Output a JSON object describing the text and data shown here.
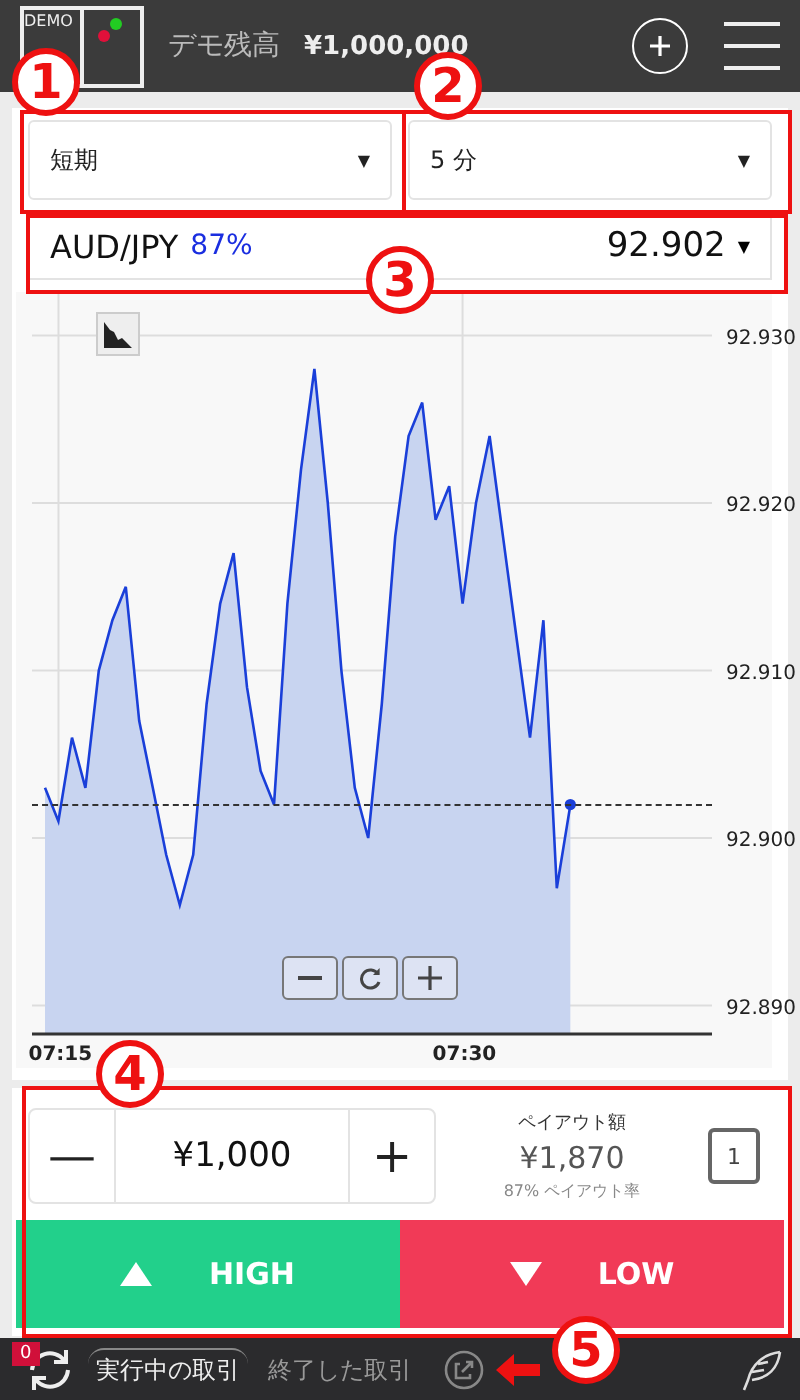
{
  "header": {
    "logo_text": "DEMO",
    "balance_label": "デモ残高",
    "balance": "¥1,000,000"
  },
  "selectors": [
    {
      "value": "短期",
      "caret": "▼"
    },
    {
      "value": "5 分",
      "caret": "▼"
    }
  ],
  "asset": {
    "pair": "AUD/JPY",
    "payout": "87%",
    "price": "92.902",
    "caret": "▼"
  },
  "chart": {
    "chart_data": {
      "type": "area",
      "categories": [
        null,
        "07:15",
        null,
        null,
        null,
        null,
        null,
        null,
        null,
        null,
        null,
        null,
        null,
        null,
        null,
        null,
        null,
        null,
        null,
        null,
        null,
        null,
        null,
        null,
        null,
        null,
        null,
        null,
        null,
        null,
        null,
        "07:30",
        null,
        null,
        null,
        null,
        null,
        null,
        null,
        null
      ],
      "series": [
        {
          "color": "#1a3fd9",
          "values": [
            92.903,
            92.901,
            92.906,
            92.903,
            92.91,
            92.913,
            92.915,
            92.907,
            92.903,
            92.899,
            92.896,
            92.899,
            92.908,
            92.914,
            92.917,
            92.909,
            92.904,
            92.902,
            92.914,
            92.922,
            92.928,
            92.92,
            92.91,
            92.903,
            92.9,
            92.908,
            92.918,
            92.924,
            92.926,
            92.919,
            92.921,
            92.914,
            92.92,
            92.924,
            92.918,
            92.912,
            92.906,
            92.913,
            92.897,
            92.902
          ]
        }
      ],
      "ylim": [
        92.8883,
        92.9326
      ],
      "grid": true,
      "yticks": [
        {
          "value": 92.93,
          "label": "92.930"
        },
        {
          "value": 92.92,
          "label": "92.920"
        },
        {
          "value": 92.91,
          "label": "92.910"
        },
        {
          "value": 92.9,
          "label": "92.900"
        },
        {
          "value": 92.89,
          "label": "92.890"
        }
      ]
    }
  },
  "trade": {
    "minus": "—",
    "amount": "¥1,000",
    "plus": "+",
    "payout_label": "ペイアウト額",
    "payout_amount": "¥1,870",
    "payout_rate": "87% ペイアウト率",
    "quantity": "1",
    "buttons": [
      {
        "label": "HIGH",
        "kind": "high"
      },
      {
        "label": "LOW",
        "kind": "low"
      }
    ]
  },
  "footer": {
    "badge": "0",
    "tabs": [
      {
        "label": "実行中の取引",
        "selected": true
      },
      {
        "label": "終了した取引",
        "selected": false
      }
    ]
  },
  "callouts": [
    "1",
    "2",
    "3",
    "4",
    "5"
  ]
}
